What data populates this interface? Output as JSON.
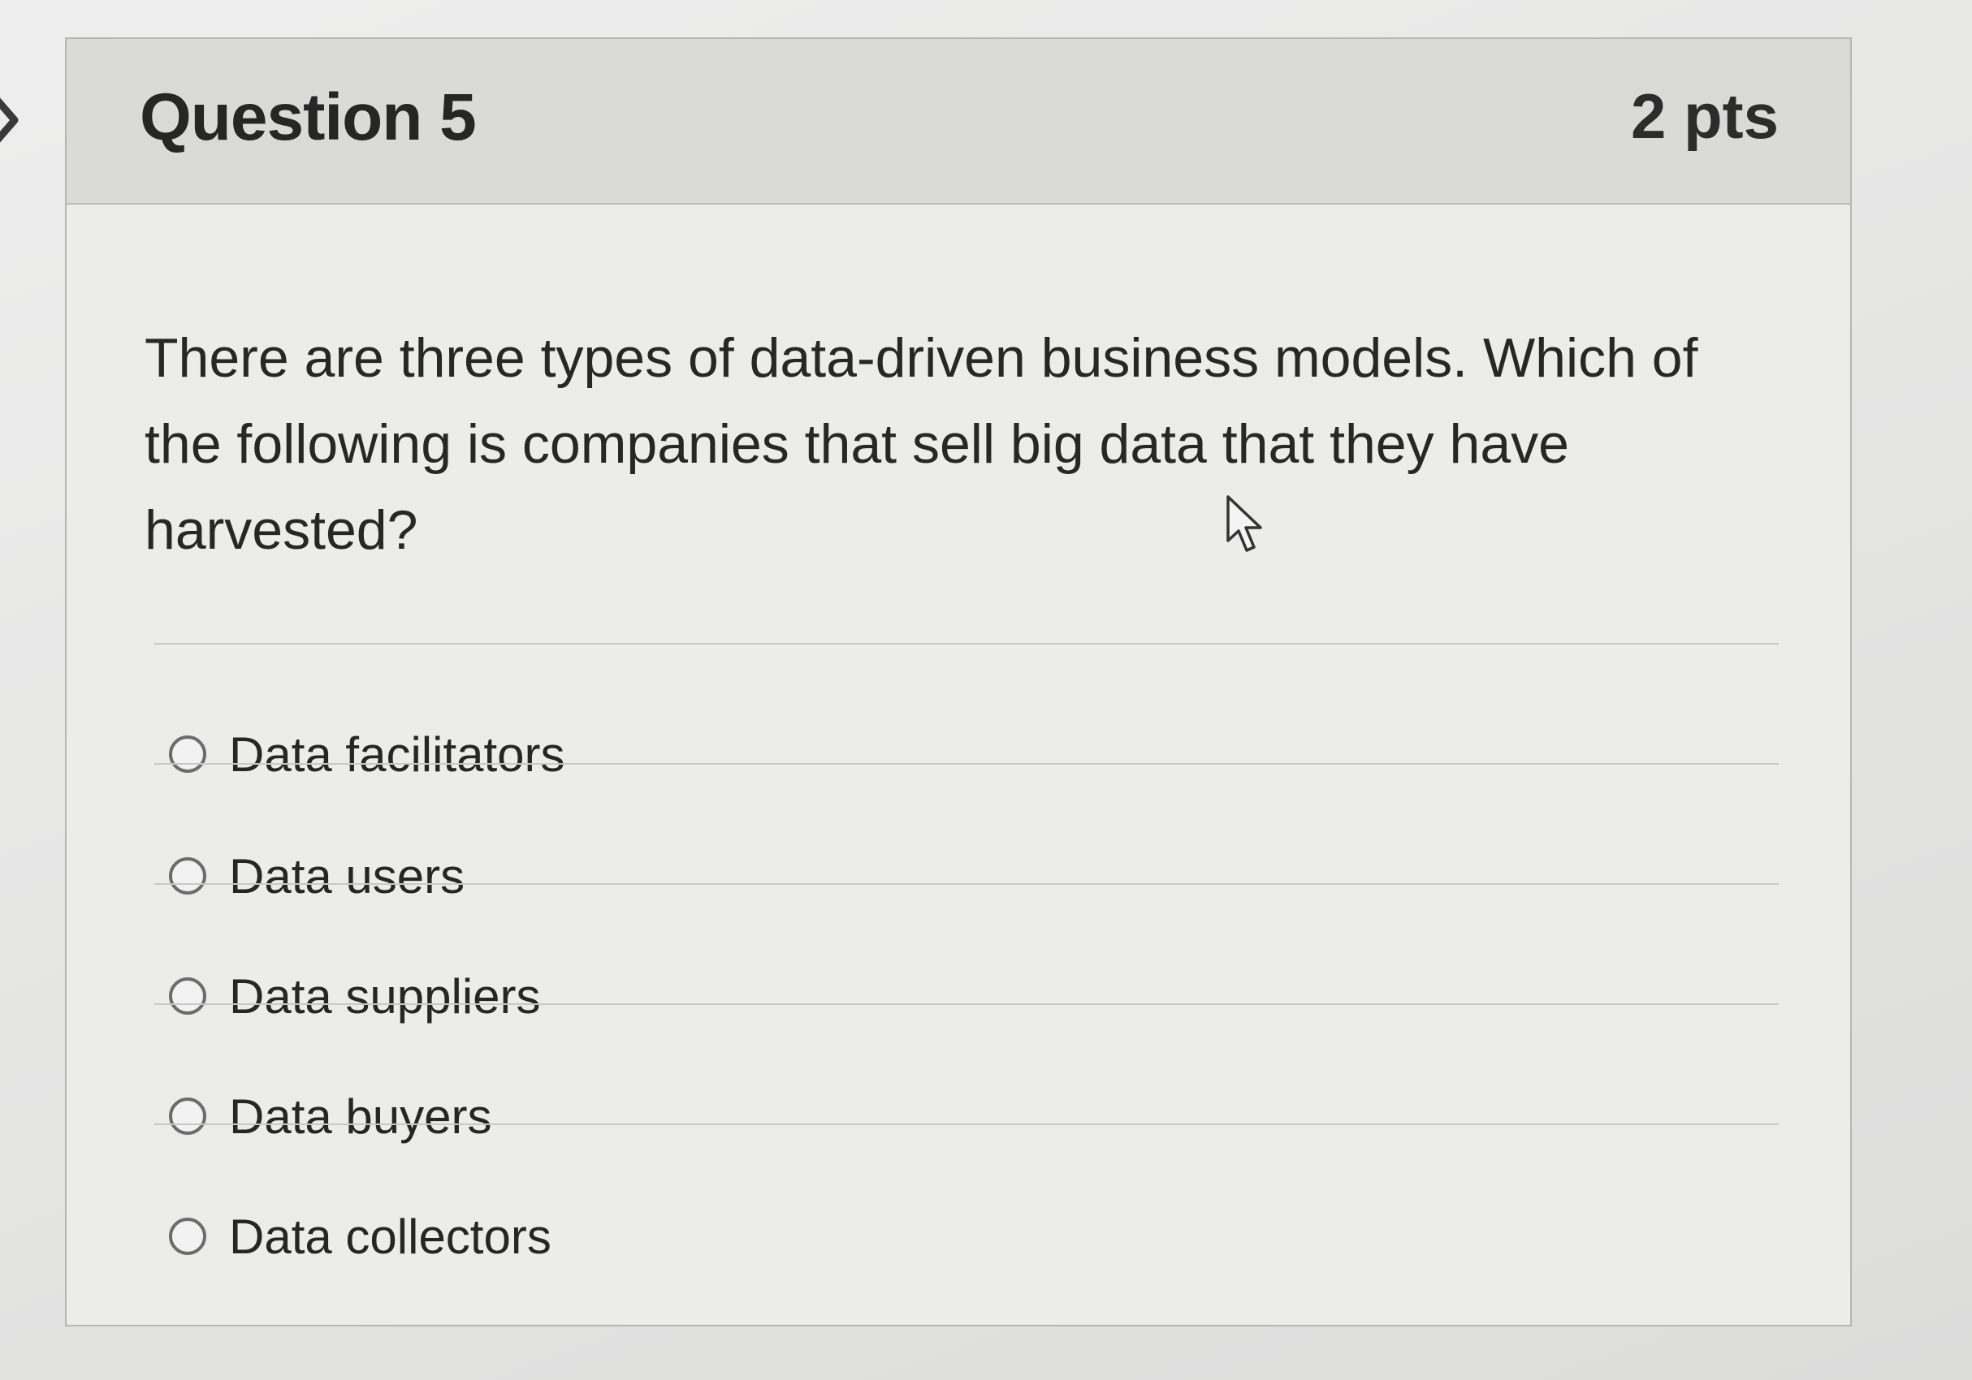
{
  "question": {
    "title": "Question 5",
    "points": "2 pts",
    "text": "There are three types of data-driven business models. Which of the following is companies that sell big data that they have harvested?"
  },
  "answers": [
    {
      "label": "Data facilitators",
      "selected": false
    },
    {
      "label": "Data users",
      "selected": false
    },
    {
      "label": "Data suppliers",
      "selected": false
    },
    {
      "label": "Data buyers",
      "selected": false
    },
    {
      "label": "Data collectors",
      "selected": false
    }
  ],
  "icons": {
    "nav": "chevron-right-icon",
    "cursor": "mouse-pointer-icon"
  },
  "colors": {
    "header_background": "#dadad9",
    "card_background": "#ececeb",
    "text": "#262626",
    "border": "#b6b6b6"
  }
}
